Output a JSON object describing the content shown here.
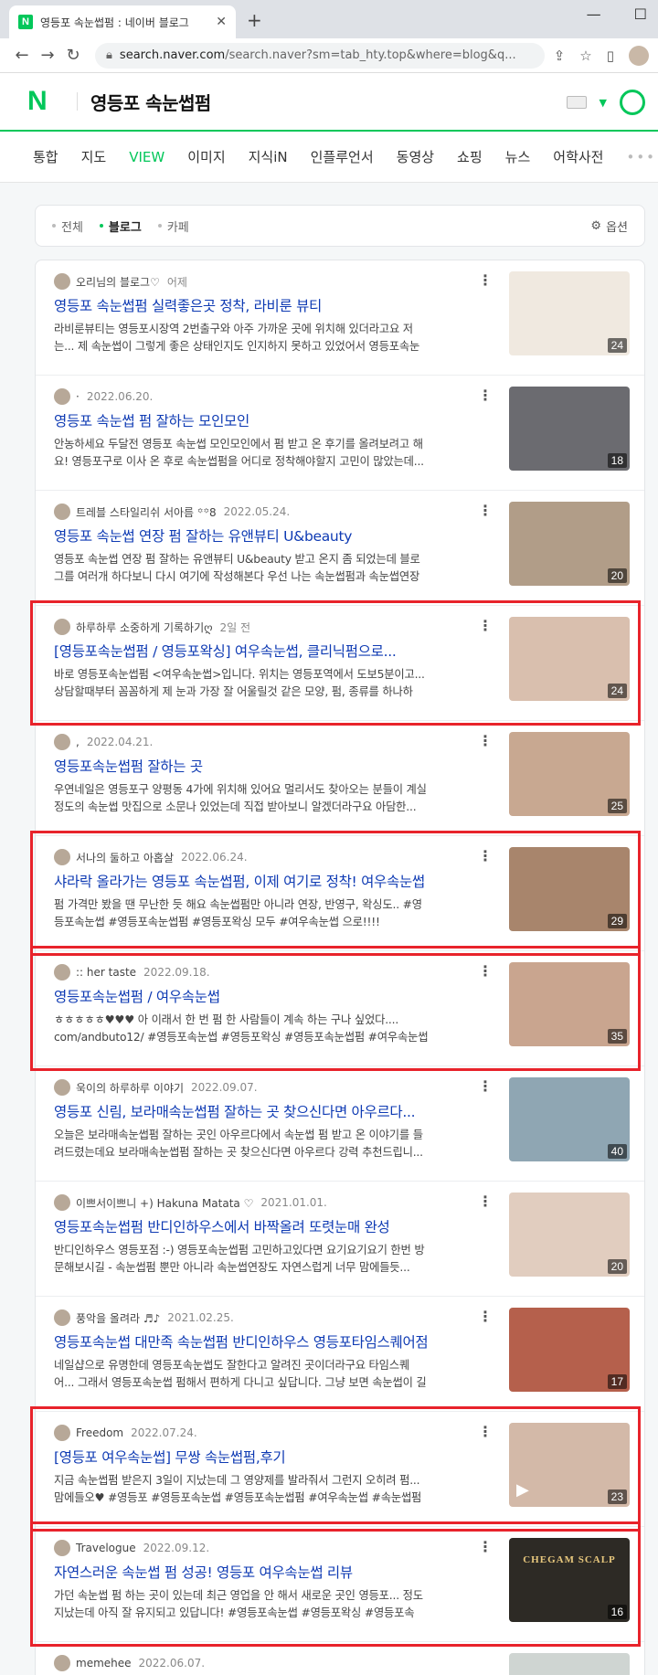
{
  "browser": {
    "tab_title": "영등포 속눈썹펌 : 네이버 블로그",
    "favicon_letter": "N",
    "url_host": "search.naver.com",
    "url_rest": "/search.naver?sm=tab_hty.top&where=blog&q..."
  },
  "naver": {
    "logo": "N",
    "query": "영등포 속눈썹펌",
    "brand_color": "#03c75a"
  },
  "search_tabs": [
    {
      "label": "통합"
    },
    {
      "label": "지도"
    },
    {
      "label": "VIEW",
      "active": true
    },
    {
      "label": "이미지"
    },
    {
      "label": "지식iN"
    },
    {
      "label": "인플루언서"
    },
    {
      "label": "동영상"
    },
    {
      "label": "쇼핑"
    },
    {
      "label": "뉴스"
    },
    {
      "label": "어학사전"
    }
  ],
  "filters": {
    "items": [
      {
        "label": "전체"
      },
      {
        "label": "블로그",
        "active": true
      },
      {
        "label": "카페"
      }
    ],
    "options_label": "옵션"
  },
  "results": [
    {
      "author": "오리님의 블로그♡",
      "date": "어제",
      "title": "영등포 속눈썹펌 실력좋은곳 정착, 라비룬 뷰티",
      "desc": "라비룬뷰티는 영등포시장역 2번출구와 아주 가까운 곳에 위치해 있더라고요 저는... 제 속눈썹이 그렇게 좋은 상태인지도 인지하지 못하고 있었어서 영등포속눈썹펌...",
      "count": "24",
      "thumb_color": "#f0e9e0",
      "highlight": false
    },
    {
      "author": "·",
      "date": "2022.06.20.",
      "title": "영등포 속눈썹 펌 잘하는 모인모인",
      "desc": "안농하세요 두달전 영등포 속눈썹 모인모인에서 펌 받고 온 후기를 올려보려고 해요! 영등포구로 이사 온 후로 속눈썹펌을 어디로 정착해야할지 고민이 많았는데...",
      "count": "18",
      "thumb_color": "#6b6b70",
      "highlight": false
    },
    {
      "author": "트레블 스타일리쉬 서아름 ꙳꙳8",
      "date": "2022.05.24.",
      "title": "영등포 속눈썹 연장 펌 잘하는 유앤뷰티 U&beauty",
      "desc": "영등포 속눈썹 연장 펌 잘하는 유앤뷰티 U&beauty 받고 온지 좀 되었는데 블로그를 여러개 하다보니 다시 여기에 작성해본다 우선 나는 속눈썹펌과 속눈썹연장을...",
      "count": "20",
      "thumb_color": "#b19d88",
      "highlight": false
    },
    {
      "author": "하루하루 소중하게 기록하기ღ",
      "date": "2일 전",
      "title": "[영등포속눈썹펌 / 영등포왁싱] 여우속눈썹, 클리닉펌으로...",
      "desc": "바로 영등포속눈썹펌 <여우속눈썹>입니다. 위치는 영등포역에서 도보5분이고... 상담할때부터 꼼꼼하게 제 눈과 가장 잘 어울릴것 같은 모양, 펌, 종류를 하나하나...",
      "count": "24",
      "thumb_color": "#d9bfae",
      "highlight": true
    },
    {
      "author": ",",
      "date": "2022.04.21.",
      "title": "영등포속눈썹펌 잘하는 곳",
      "desc": "우연네일은 영등포구 양평동 4가에 위치해 있어요 멀리서도 찾아오는 분들이 계실 정도의 속눈썹 맛집으로 소문나 있었는데 직접 받아보니 알겠더라구요 아담한...",
      "count": "25",
      "thumb_color": "#c8a891",
      "highlight": false
    },
    {
      "author": "서나의 둘하고 아홉살",
      "date": "2022.06.24.",
      "title": "샤라락 올라가는 영등포 속눈썹펌, 이제 여기로 정착! 여우속눈썹",
      "desc": "펌 가격만 봤을 땐 무난한 듯 해요 속눈썹펌만 아니라 연장, 반영구, 왁싱도.. #영등포속눈썹 #영등포속눈썹펌 #영등포왁싱 모두 #여우속눈썹 으로!!!!",
      "count": "29",
      "thumb_color": "#a8856c",
      "highlight": true
    },
    {
      "author": ":: her taste",
      "date": "2022.09.18.",
      "title": "영등포속눈썹펌 / 여우속눈썹",
      "desc": "ㅎㅎㅎㅎㅎ♥♥♥ 아 이래서 한 번 펌 한 사람들이 계속 하는 구나 싶었다.... com/andbuto12/ #영등포속눈썹 #영등포왁싱 #영등포속눈썹펌 #여우속눈썹 #영등포속...",
      "count": "35",
      "thumb_color": "#c9a58f",
      "highlight": true
    },
    {
      "author": "욱이의 하루하루 이야기",
      "date": "2022.09.07.",
      "title": "영등포 신림, 보라매속눈썹펌 잘하는 곳 찾으신다면 아우르다...",
      "desc": "오늘은 보라매속눈썹펌 잘하는 곳인 아우르다에서 속눈썹 펌 받고 온 이야기를 들려드렸는데요 보라매속눈썹펌 잘하는 곳 찾으신다면 아우르다 강력 추천드립니...",
      "count": "40",
      "thumb_color": "#8fa6b3",
      "highlight": false
    },
    {
      "author": "이쁘서이쁘니 +) Hakuna Matata ♡",
      "date": "2021.01.01.",
      "title": "영등포속눈썹펌 반디인하우스에서 바짝올려 또렷눈매 완성",
      "desc": "반디인하우스 영등포점 :-) 영등포속눈썹펌 고민하고있다면 요기요기요기 한번 방문해보시길 - 속눈썹펌 뿐만 아니라 속눈썹연장도 자연스럽게 너무 맘에들듯...",
      "count": "20",
      "thumb_color": "#e1cdbf",
      "highlight": false
    },
    {
      "author": "풍악을 올려라 ♬♪",
      "date": "2021.02.25.",
      "title": "영등포속눈썹 대만족 속눈썹펌 반디인하우스 영등포타임스퀘어점",
      "desc": "네일샵으로 유명한데 영등포속눈썹도 잘한다고 알려진 곳이더라구요 타임스퀘어... 그래서 영등포속눈썹 펌해서 편하게 다니고 싶답니다. 그냥 보면 속눈썹이 길고...",
      "count": "17",
      "thumb_color": "#b5604c",
      "highlight": false
    },
    {
      "author": "Freedom",
      "date": "2022.07.24.",
      "title": "[영등포 여우속눈썹] 무쌍 속눈썹펌,후기",
      "desc": "지금 속눈썹펌 받은지 3일이 지났는데 그 영양제를 발라줘서 그런지 오히려 펌... 맘에들오♥ #영등포 #영등포속눈썹 #영등포속눈썹펌 #여우속눈썹 #속눈썹펌 #무...",
      "count": "23",
      "thumb_color": "#d3b9a8",
      "highlight": true,
      "video": true
    },
    {
      "author": "Travelogue",
      "date": "2022.09.12.",
      "title": "자연스러운 속눈썹 펌 성공! 영등포 여우속눈썹 리뷰",
      "desc": "가던 속눈썹 펌 하는 곳이 있는데 최근 영업을 안 해서 새로운 곳인 영등포... 정도 지났는데 아직 잘 유지되고 있답니다! #영등포속눈썹 #영등포왁싱 #영등포속눈...",
      "count": "16",
      "thumb_color": "#2d2a25",
      "highlight": true,
      "brand": "CHEGAM SCALP"
    },
    {
      "author": "memehee",
      "date": "2022.06.07.",
      "title": "",
      "desc": "",
      "count": "",
      "thumb_color": "#cfd5d2",
      "highlight": false
    }
  ]
}
